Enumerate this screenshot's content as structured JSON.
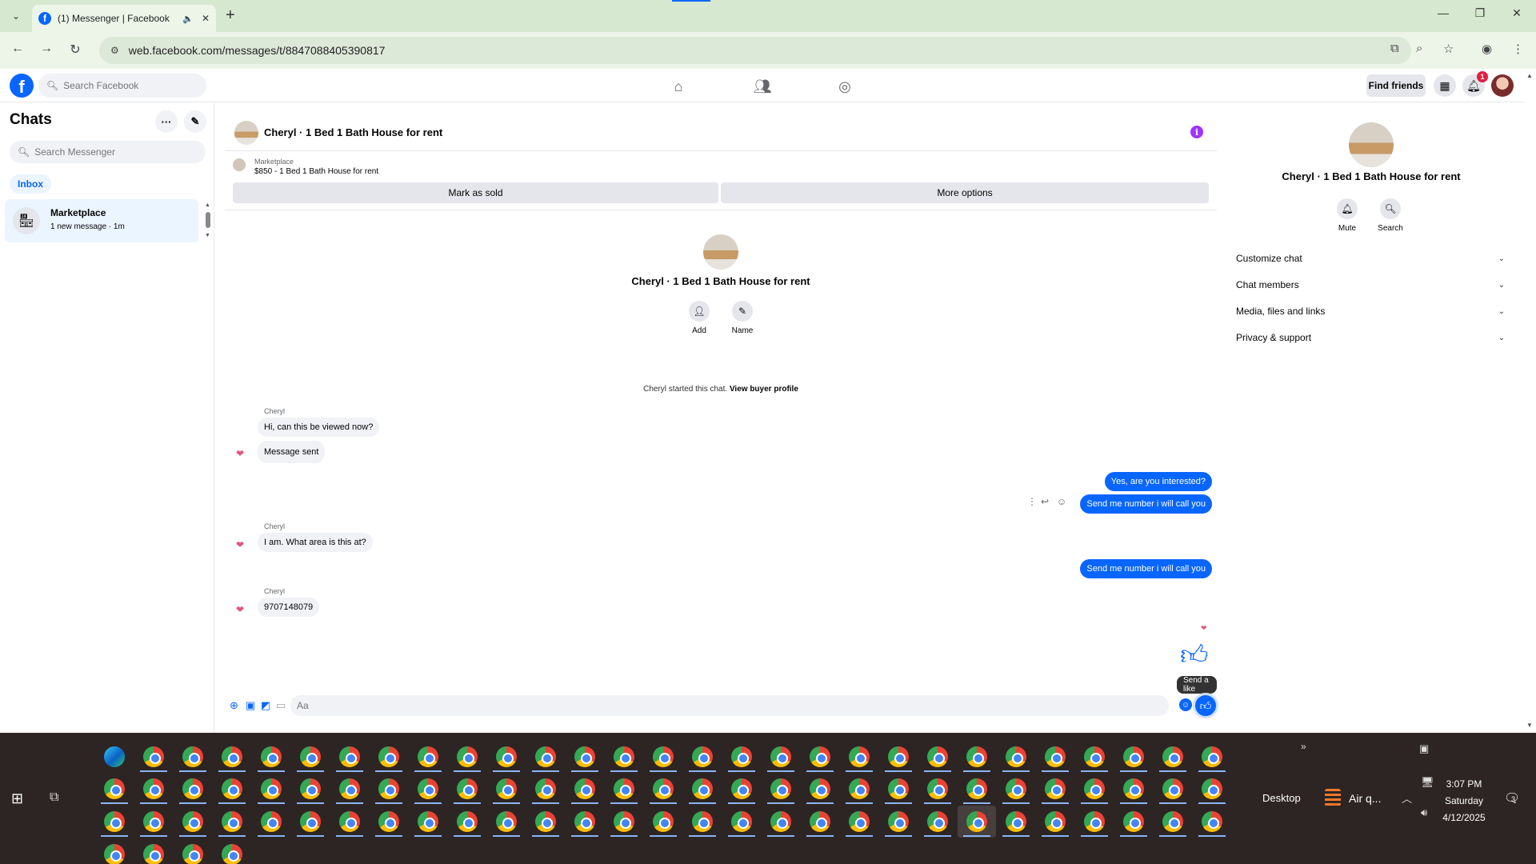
{
  "browser": {
    "tab_title": "(1) Messenger | Facebook",
    "new_tab": "+",
    "url": "web.facebook.com/messages/t/8847088405390817"
  },
  "fb_header": {
    "search_placeholder": "Search Facebook",
    "find_friends": "Find friends",
    "notification_count": "1"
  },
  "sidebar": {
    "title": "Chats",
    "search_placeholder": "Search Messenger",
    "filter": "Inbox",
    "conversations": [
      {
        "name": "Marketplace",
        "preview": "1 new message · 1m"
      }
    ]
  },
  "conversation": {
    "title": "Cheryl · 1 Bed 1 Bath House for rent",
    "marketplace_label": "Marketplace",
    "listing": "$850 - 1 Bed 1 Bath House for rent",
    "mark_sold": "Mark as sold",
    "more_options": "More options",
    "intro_title": "Cheryl · 1 Bed 1 Bath House for rent",
    "intro_actions": [
      {
        "label": "Add"
      },
      {
        "label": "Name"
      }
    ],
    "started_text": "Cheryl started this chat.",
    "view_profile": "View buyer profile",
    "messages": [
      {
        "sender": "Cheryl",
        "text": "Hi, can this be viewed now?"
      },
      {
        "text": "Message sent"
      },
      {
        "text": "Yes, are you interested?"
      },
      {
        "text": "Send me number i will call you"
      },
      {
        "sender": "Cheryl",
        "text": "I am. What area is this at?"
      },
      {
        "text": "Send me number i will call you"
      },
      {
        "sender": "Cheryl",
        "text": "9707148079"
      }
    ],
    "tooltip": "Send a like",
    "composer_placeholder": "Aa"
  },
  "info_panel": {
    "title": "Cheryl · 1 Bed 1 Bath House for rent",
    "actions": [
      {
        "label": "Mute"
      },
      {
        "label": "Search"
      }
    ],
    "sections": [
      {
        "label": "Customize chat"
      },
      {
        "label": "Chat members"
      },
      {
        "label": "Media, files and links"
      },
      {
        "label": "Privacy & support"
      }
    ]
  },
  "taskbar": {
    "desktop": "Desktop",
    "weather": "Air q...",
    "time": "3:07 PM",
    "day": "Saturday",
    "date": "4/12/2025",
    "notifications": "3"
  },
  "colors": {
    "accent": "#0866ff",
    "info_purple": "#a033ff",
    "browser_frame": "#d6e8cf",
    "taskbar": "#2d2523"
  }
}
